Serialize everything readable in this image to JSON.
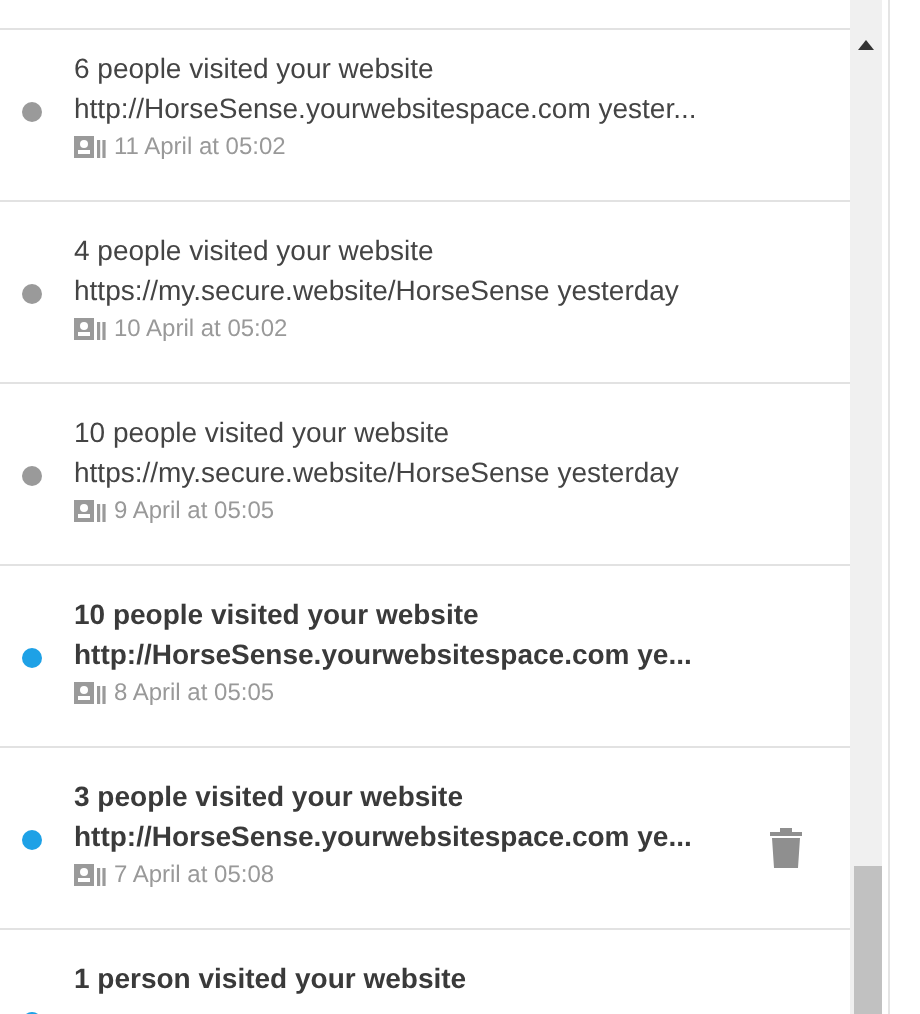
{
  "notifications": [
    {
      "title": "6 people visited your website",
      "detail": "http://HorseSense.yourwebsitespace.com yester...",
      "date": "11 April at 05:02",
      "unread": false,
      "delete_shown": false
    },
    {
      "title": "4 people visited your website",
      "detail": "https://my.secure.website/HorseSense yesterday",
      "date": "10 April at 05:02",
      "unread": false,
      "delete_shown": false
    },
    {
      "title": "10 people visited your website",
      "detail": "https://my.secure.website/HorseSense yesterday",
      "date": "9 April at 05:05",
      "unread": false,
      "delete_shown": false
    },
    {
      "title": "10 people visited your website",
      "detail": "http://HorseSense.yourwebsitespace.com ye...",
      "date": "8 April at 05:05",
      "unread": true,
      "delete_shown": false
    },
    {
      "title": "3 people visited your website",
      "detail": "http://HorseSense.yourwebsitespace.com ye...",
      "date": "7 April at 05:08",
      "unread": true,
      "delete_shown": true
    },
    {
      "title": "1 person visited your website",
      "unread": true,
      "delete_shown": false
    }
  ]
}
